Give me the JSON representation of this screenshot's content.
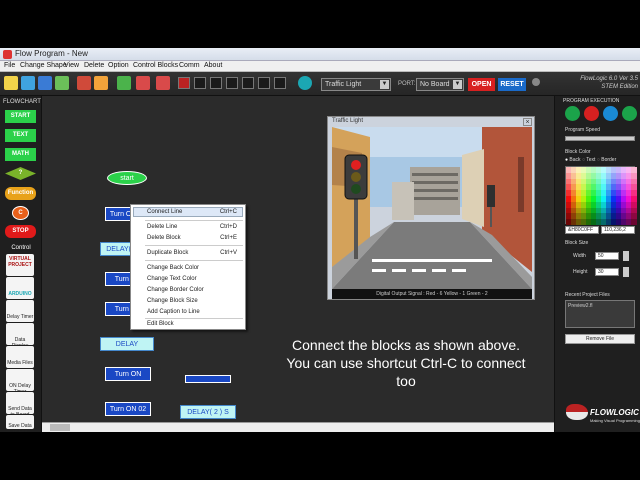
{
  "window": {
    "title": "Flow Program - New"
  },
  "menu": [
    "File",
    "Change Shape",
    "View",
    "Delete",
    "Option",
    "Control Blocks",
    "Comm",
    "About"
  ],
  "toolbar": {
    "simulation_select": "Traffic Light",
    "port_label": "PORT:",
    "board_select": "No Board",
    "open_label": "OPEN",
    "reset_label": "RESET",
    "version_line1": "FlowLogic 6.0 Ver 3.5",
    "version_line2": "STEM Edition"
  },
  "palette": {
    "title": "FLOWCHART",
    "blocks": [
      {
        "label": "START",
        "color": "#2bd14a",
        "text_color": "#ffffff"
      },
      {
        "label": "TEXT",
        "color": "#2bd14a",
        "text_color": "#ffffff"
      },
      {
        "label": "MATH",
        "color": "#2bd14a",
        "text_color": "#ffffff"
      },
      {
        "label": "?",
        "color": "#7ab32a",
        "text_color": "#ffffff"
      },
      {
        "label": "Function",
        "color": "#e8a21a",
        "text_color": "#ffffff"
      },
      {
        "label": "C",
        "color": "#e8601a",
        "text_color": "#ffffff"
      },
      {
        "label": "STOP",
        "color": "#e01a1a",
        "text_color": "#ffffff"
      }
    ],
    "control_label": "Control",
    "tools": [
      "VIRTUAL PROJECT",
      "ARDUINO",
      "Delay Timer",
      "Data Display",
      "Media Files",
      "ON Delay Timer",
      "Send Data to Board",
      "Save Data to File"
    ]
  },
  "canvas": {
    "start_label": "start",
    "blocks": [
      "Turn ON 03",
      "DELAY( 2 ) S",
      "Turn ON",
      "Turn ON",
      "DELAY",
      "Turn ON",
      "Turn ON 02",
      "DELAY( 2 ) S"
    ]
  },
  "context_menu": [
    {
      "label": "Connect Line",
      "shortcut": "Ctrl+C"
    },
    {
      "label": "Delete Line",
      "shortcut": "Ctrl+D"
    },
    {
      "label": "Delete Block",
      "shortcut": "Ctrl+E"
    },
    {
      "label": "Duplicate Block",
      "shortcut": "Ctrl+V"
    },
    {
      "label": "Change Back Color",
      "shortcut": ""
    },
    {
      "label": "Change Text Color",
      "shortcut": ""
    },
    {
      "label": "Change Border Color",
      "shortcut": ""
    },
    {
      "label": "Change Block Size",
      "shortcut": ""
    },
    {
      "label": "Add Caption to Line",
      "shortcut": ""
    },
    {
      "label": "Edit Block",
      "shortcut": ""
    }
  ],
  "traffic_window": {
    "title": "Traffic Light",
    "status": "Digital Output Signal :  Red - 6    Yellow - 1    Green - 2"
  },
  "right_panel": {
    "execution_title": "PROGRAM EXECUTION",
    "speed_label": "Program Speed",
    "block_color_label": "Block Color",
    "color_targets": [
      "Back",
      "Text",
      "Border"
    ],
    "hex_value": "&H80C0FF",
    "rgb_value": "110,236,2",
    "block_size_label": "Block Size",
    "width_label": "Width",
    "width_value": "50",
    "height_label": "Height",
    "height_value": "30",
    "recent_label": "Recent Project Files",
    "recent_item": "Preview2.fl",
    "remove_label": "Remove File"
  },
  "caption": {
    "line1": "Connect the blocks as shown above.",
    "line2": "You can use shortcut Ctrl-C to connect",
    "line3": "too"
  },
  "logo": {
    "text": "FLOWLOGIC",
    "subtext": "Making Visual Programming"
  }
}
